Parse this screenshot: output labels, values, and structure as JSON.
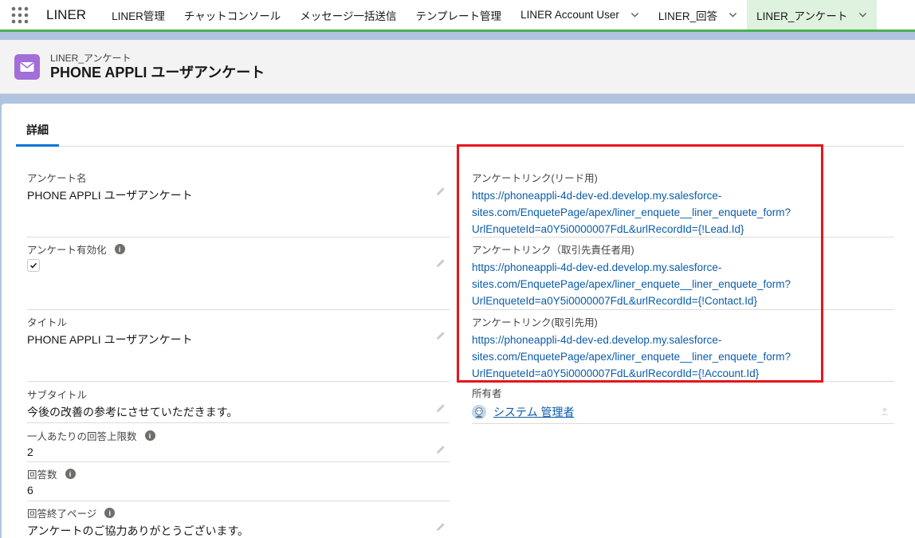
{
  "app": {
    "name": "LINER"
  },
  "nav": {
    "items": [
      {
        "label": "LINER管理"
      },
      {
        "label": "チャットコンソール"
      },
      {
        "label": "メッセージ一括送信"
      },
      {
        "label": "テンプレート管理"
      },
      {
        "label": "LINER Account User"
      },
      {
        "label": "LINER_回答"
      },
      {
        "label": "LINER_アンケート"
      }
    ]
  },
  "header": {
    "object_label": "LINER_アンケート",
    "record_name": "PHONE APPLI ユーザアンケート"
  },
  "tabs": {
    "details": "詳細"
  },
  "fields": {
    "survey_name": {
      "label": "アンケート名",
      "value": "PHONE APPLI ユーザアンケート"
    },
    "survey_enabled": {
      "label": "アンケート有効化",
      "checked": true
    },
    "title": {
      "label": "タイトル",
      "value": "PHONE APPLI ユーザアンケート"
    },
    "subtitle": {
      "label": "サブタイトル",
      "value": "今後の改善の参考にさせていただきます。"
    },
    "answer_limit": {
      "label": "一人あたりの回答上限数",
      "value": "2"
    },
    "answer_count": {
      "label": "回答数",
      "value": "6"
    },
    "end_page": {
      "label": "回答終了ページ",
      "value": "アンケートのご協力ありがとうございます。"
    },
    "link_lead": {
      "label": "アンケートリンク(リード用)",
      "line1": "https://phoneappli-4d-dev-ed.develop.my.salesforce-",
      "line2": "sites.com/EnquetePage/apex/liner_enquete__liner_enquete_form?",
      "line3": "UrlEnqueteId=a0Y5i0000007FdL&urlRecordId={!Lead.Id}"
    },
    "link_contact": {
      "label": "アンケートリンク（取引先責任者用)",
      "line1": "https://phoneappli-4d-dev-ed.develop.my.salesforce-",
      "line2": "sites.com/EnquetePage/apex/liner_enquete__liner_enquete_form?",
      "line3": "UrlEnqueteId=a0Y5i0000007FdL&urlRecordId={!Contact.Id}"
    },
    "link_account": {
      "label": "アンケートリンク(取引先用)",
      "line1": "https://phoneappli-4d-dev-ed.develop.my.salesforce-",
      "line2": "sites.com/EnquetePage/apex/liner_enquete__liner_enquete_form?",
      "line3": "UrlEnqueteId=a0Y5i0000007FdL&urlRecordId={!Account.Id}"
    },
    "owner": {
      "label": "所有者",
      "value": "システム 管理者"
    }
  },
  "colors": {
    "nav_accent": "#4bb04f",
    "object_icon": "#a26ed8",
    "link": "#0b5cab",
    "highlight_box": "#e8141a"
  },
  "icons": [
    "app-launcher-icon",
    "chevron-down-icon",
    "envelope-icon",
    "pencil-icon",
    "info-icon",
    "checkmark-icon",
    "user-avatar-icon",
    "change-owner-icon"
  ]
}
